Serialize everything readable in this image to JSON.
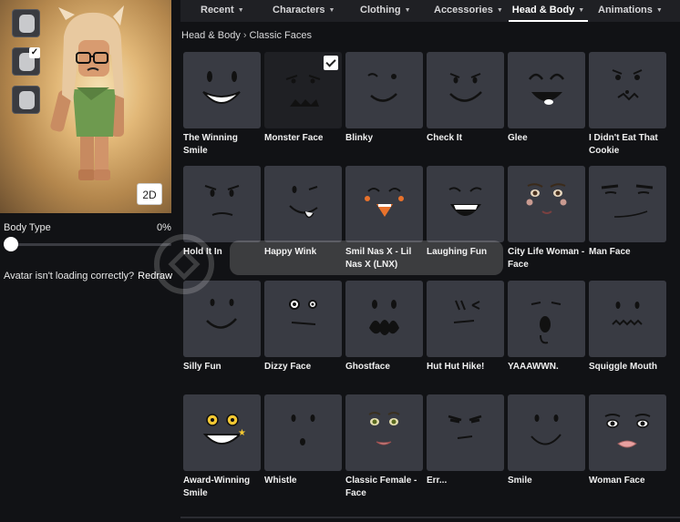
{
  "nav": {
    "tabs": [
      {
        "label": "Recent",
        "has_chevron": true
      },
      {
        "label": "Characters",
        "has_chevron": true
      },
      {
        "label": "Clothing",
        "has_chevron": true
      },
      {
        "label": "Accessories",
        "has_chevron": true
      },
      {
        "label": "Head & Body",
        "has_chevron": true,
        "active": true
      },
      {
        "label": "Animations",
        "has_chevron": true
      }
    ]
  },
  "breadcrumb": {
    "parent": "Head & Body",
    "current": "Classic Faces"
  },
  "avatar_panel": {
    "view_toggle": "2D",
    "body_type_label": "Body Type",
    "body_type_value": "0%",
    "loading_text": "Avatar isn't loading correctly?",
    "redraw_label": "Redraw"
  },
  "items": [
    {
      "name": "The Winning Smile",
      "face": "winning"
    },
    {
      "name": "Monster Face",
      "face": "monster",
      "selected": true
    },
    {
      "name": "Blinky",
      "face": "blinky"
    },
    {
      "name": "Check It",
      "face": "checkit"
    },
    {
      "name": "Glee",
      "face": "glee"
    },
    {
      "name": "I Didn't Eat That Cookie",
      "face": "cookie"
    },
    {
      "name": "Hold It In",
      "face": "holdit"
    },
    {
      "name": "Happy Wink",
      "face": "wink"
    },
    {
      "name": "Smil Nas X - Lil Nas X (LNX)",
      "face": "lnx"
    },
    {
      "name": "Laughing Fun",
      "face": "laughing"
    },
    {
      "name": "City Life Woman - Face",
      "face": "citylife"
    },
    {
      "name": "Man Face",
      "face": "man"
    },
    {
      "name": "Silly Fun",
      "face": "silly"
    },
    {
      "name": "Dizzy Face",
      "face": "dizzy"
    },
    {
      "name": "Ghostface",
      "face": "ghost"
    },
    {
      "name": "Hut Hut Hike!",
      "face": "hut"
    },
    {
      "name": "YAAAWWN.",
      "face": "yawn"
    },
    {
      "name": "Squiggle Mouth",
      "face": "squiggle"
    },
    {
      "name": "Award-Winning Smile",
      "face": "award"
    },
    {
      "name": "Whistle",
      "face": "whistle"
    },
    {
      "name": "Classic Female - Face",
      "face": "female"
    },
    {
      "name": "Err...",
      "face": "err"
    },
    {
      "name": "Smile",
      "face": "smile"
    },
    {
      "name": "Woman Face",
      "face": "woman"
    }
  ]
}
